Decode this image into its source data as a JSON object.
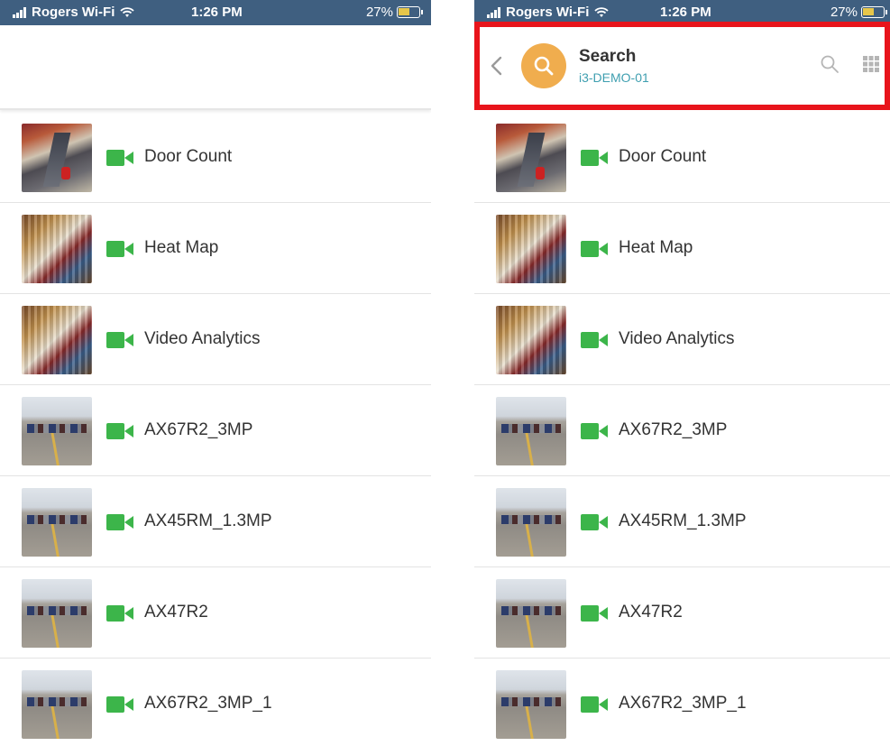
{
  "status_bar": {
    "carrier": "Rogers Wi-Fi",
    "time": "1:26 PM",
    "battery": "27%"
  },
  "header": {
    "title": "Search",
    "subtitle": "i3-DEMO-01",
    "icons": [
      "chevron-left-icon",
      "search-icon",
      "search-icon",
      "grid-icon"
    ]
  },
  "cameras": [
    {
      "label": "Door Count",
      "thumbnail": "store-door"
    },
    {
      "label": "Heat Map",
      "thumbnail": "store-aisle"
    },
    {
      "label": "Video Analytics",
      "thumbnail": "store-aisle"
    },
    {
      "label": "AX67R2_3MP",
      "thumbnail": "parking-lot"
    },
    {
      "label": "AX45RM_1.3MP",
      "thumbnail": "parking-lot"
    },
    {
      "label": "AX47R2",
      "thumbnail": "parking-lot"
    },
    {
      "label": "AX67R2_3MP_1",
      "thumbnail": "parking-lot"
    }
  ],
  "colors": {
    "status_bar": "#3f5f80",
    "camera_icon": "#3cb54a",
    "search_badge": "#f0ad4e",
    "subtitle": "#3f9fb0",
    "highlight_box": "#e8141b"
  }
}
